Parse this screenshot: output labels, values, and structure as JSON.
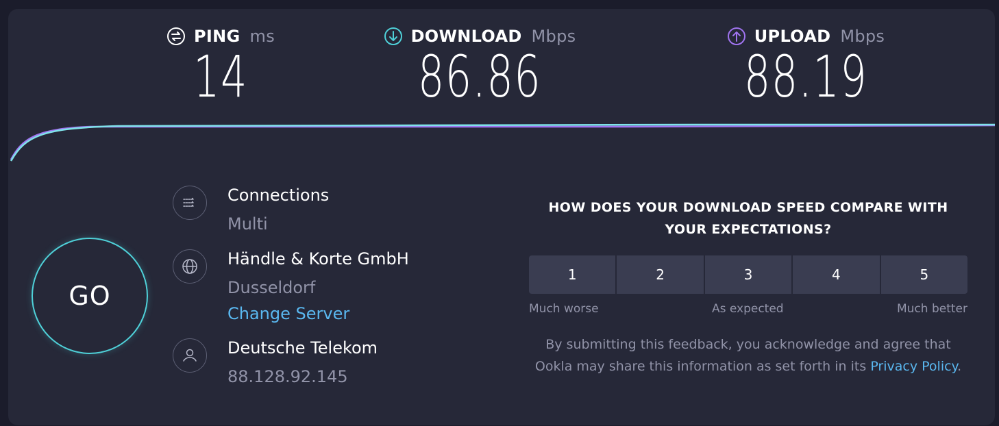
{
  "metrics": {
    "ping": {
      "label": "PING",
      "unit": "ms",
      "value": "14",
      "icon": "ping-icon"
    },
    "download": {
      "label": "DOWNLOAD",
      "unit": "Mbps",
      "value": "86.86",
      "icon": "download-arrow-icon"
    },
    "upload": {
      "label": "UPLOAD",
      "unit": "Mbps",
      "value": "88.19",
      "icon": "upload-arrow-icon"
    }
  },
  "colors": {
    "download": "#4fd1d9",
    "upload": "#a074f0",
    "link": "#5ab8f0"
  },
  "go": {
    "label": "GO"
  },
  "connections": {
    "title": "Connections",
    "value": "Multi",
    "icon": "connections-icon"
  },
  "server": {
    "name": "Händle & Korte GmbH",
    "location": "Dusseldorf",
    "change_label": "Change Server",
    "icon": "globe-icon"
  },
  "isp": {
    "name": "Deutsche Telekom",
    "ip": "88.128.92.145",
    "icon": "user-icon"
  },
  "survey": {
    "question": "HOW DOES YOUR DOWNLOAD SPEED COMPARE WITH YOUR EXPECTATIONS?",
    "options": [
      "1",
      "2",
      "3",
      "4",
      "5"
    ],
    "labels": {
      "low": "Much worse",
      "mid": "As expected",
      "high": "Much better"
    },
    "note": "By submitting this feedback, you acknowledge and agree that Ookla may share this information as set forth in its",
    "policy_link": "Privacy Policy",
    "period": "."
  }
}
